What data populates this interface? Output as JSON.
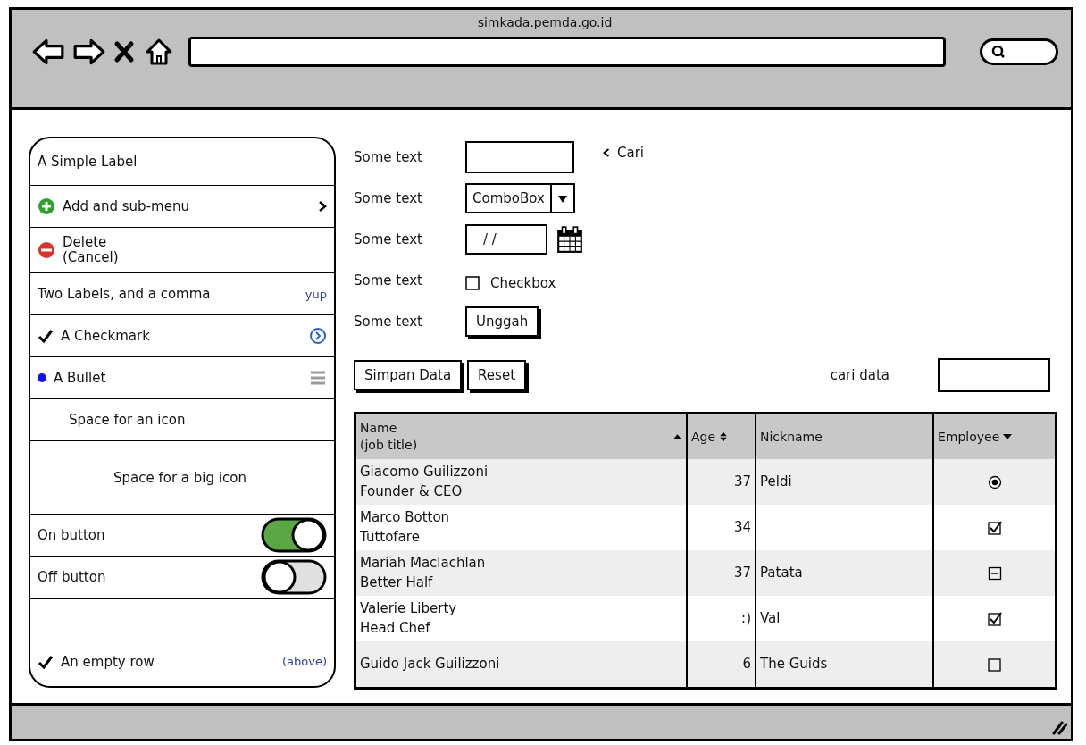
{
  "browser": {
    "url": "simkada.pemda.go.id"
  },
  "sidebar": {
    "items": [
      {
        "kind": "label",
        "text": "A Simple Label"
      },
      {
        "kind": "add",
        "text": "Add and sub-menu"
      },
      {
        "kind": "delete",
        "text": "Delete\n(Cancel)"
      },
      {
        "kind": "two_labels",
        "text": "Two Labels, and a comma",
        "secondary": "yup"
      },
      {
        "kind": "check",
        "text": "A Checkmark",
        "accessory": {
          "kind": "circle_arrow"
        }
      },
      {
        "kind": "bullet",
        "text": "A Bullet",
        "accessory": {
          "kind": "lines"
        }
      },
      {
        "kind": "icon_space",
        "text": "Space for an icon"
      },
      {
        "kind": "big_icon_space",
        "text": "Space for a big icon"
      },
      {
        "kind": "toggle",
        "text": "On button",
        "on": true
      },
      {
        "kind": "toggle",
        "text": "Off button",
        "on": false
      },
      {
        "kind": "empty"
      },
      {
        "kind": "check",
        "text": "An empty row",
        "secondary": "(above)"
      }
    ]
  },
  "form": {
    "rows": [
      {
        "label": "Some text",
        "kind": "text",
        "link": "Cari"
      },
      {
        "label": "Some text",
        "kind": "combobox",
        "value": "ComboBox"
      },
      {
        "label": "Some text",
        "kind": "date",
        "value": "/ /"
      },
      {
        "label": "Some text",
        "kind": "checkbox",
        "text": "Checkbox",
        "checked": false
      },
      {
        "label": "Some text",
        "kind": "button",
        "text": "Unggah"
      }
    ]
  },
  "actions": {
    "buttons": [
      "Simpan Data",
      "Reset"
    ],
    "search_label": "cari data"
  },
  "table": {
    "columns": [
      {
        "label": "Name\n(job title)",
        "sort": {
          "kind": "up"
        }
      },
      {
        "label": "Age",
        "sort": {
          "kind": "both"
        }
      },
      {
        "label": "Nickname"
      },
      {
        "label": "Employee",
        "sort": {
          "kind": "down"
        }
      }
    ],
    "rows": [
      {
        "name": "Giacomo Guilizzoni\nFounder & CEO",
        "age": "37",
        "nickname": "Peldi",
        "employee": {
          "kind": "radio",
          "checked": true
        }
      },
      {
        "name": "Marco Botton\nTuttofare",
        "age": "34",
        "employee": {
          "kind": "checkbox",
          "checked": true
        }
      },
      {
        "name": "Mariah Maclachlan\nBetter Half",
        "age": "37",
        "nickname": "Patata",
        "employee": {
          "kind": "mixed",
          "mixed": true
        }
      },
      {
        "name": "Valerie Liberty\nHead Chef",
        "age": ":)",
        "nickname": "Val",
        "employee": {
          "kind": "checkbox",
          "checked": true
        }
      },
      {
        "name": "Guido Jack Guilizzoni",
        "age": "6",
        "nickname": "The Guids",
        "employee": {
          "kind": "checkbox",
          "checked": false
        }
      }
    ]
  }
}
